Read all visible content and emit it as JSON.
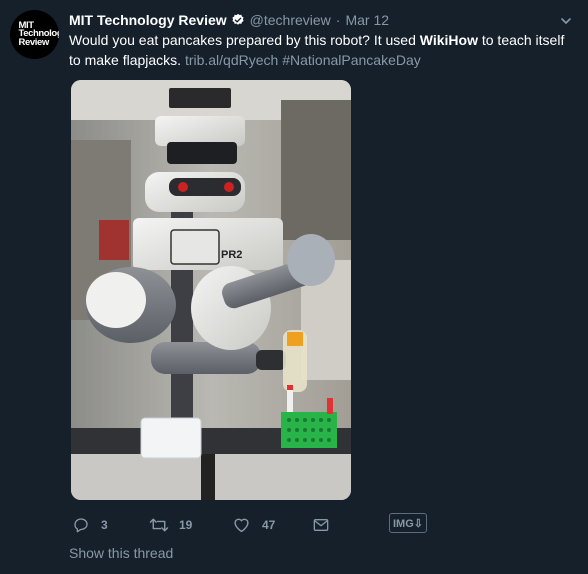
{
  "tweet": {
    "avatar_logo_lines": [
      "MIT",
      "Technology",
      "Review"
    ],
    "name": "MIT Technology Review",
    "handle": "@techreview",
    "separator": "·",
    "date": "Mar 12",
    "text_before_bold": "Would you eat pancakes prepared by this robot? It used ",
    "text_bold": "WikiHow",
    "text_after_bold": " to teach itself to make flapjacks. ",
    "link": "trib.al/qdRyech",
    "hashtag": "#NationalPancakeDay",
    "media_label": "PR2",
    "verified_icon": "verified-badge-icon",
    "caret_icon": "chevron-down-icon"
  },
  "actions": {
    "reply_count": "3",
    "retweet_count": "19",
    "like_count": "47",
    "img_badge": "IMG⇩",
    "show_thread": "Show this thread"
  },
  "colors": {
    "background": "#15202b",
    "secondary_text": "#8899a6",
    "verified": "#ffffff"
  }
}
